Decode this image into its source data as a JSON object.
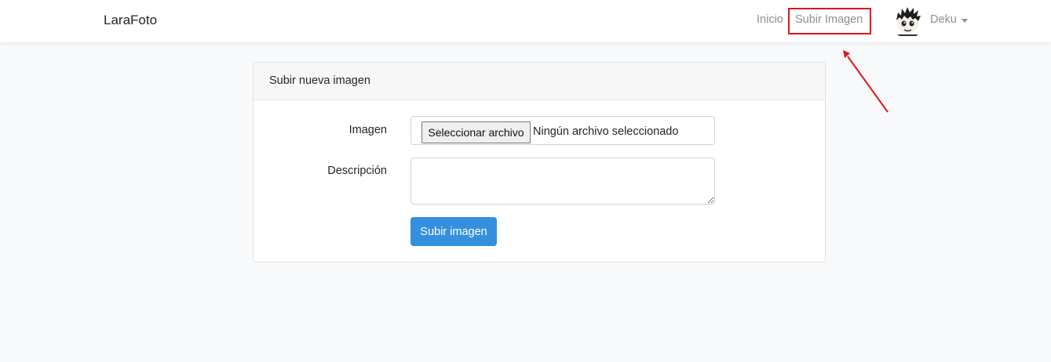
{
  "navbar": {
    "brand": "LaraFoto",
    "links": {
      "inicio": "Inicio",
      "subir": "Subir Imagen"
    },
    "user": {
      "name": "Deku",
      "avatar_icon": "user-avatar-icon"
    }
  },
  "annotation": {
    "color": "#e0141e"
  },
  "card": {
    "header": "Subir nueva imagen",
    "form": {
      "image_label": "Imagen",
      "file_button": "Seleccionar archivo",
      "file_status": "Ningún archivo seleccionado",
      "description_label": "Descripción",
      "description_value": "",
      "submit": "Subir imagen"
    }
  },
  "colors": {
    "primary": "#3490dc",
    "background": "#f8f9fa",
    "nav_link": "#8a8f94"
  }
}
